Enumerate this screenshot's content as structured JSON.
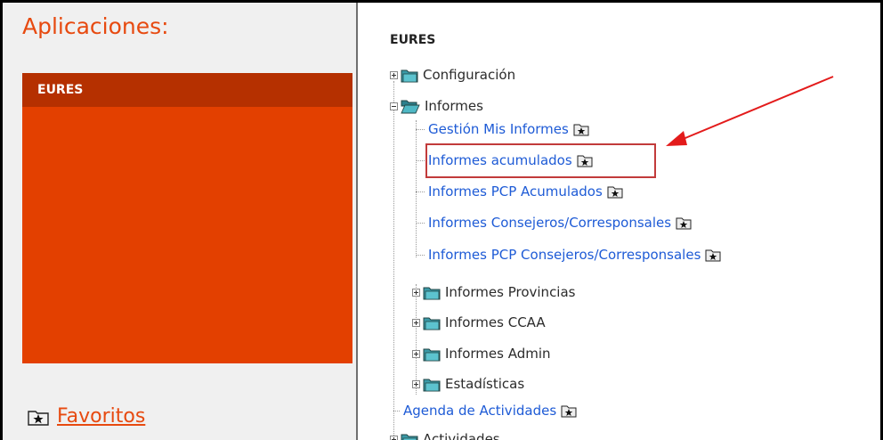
{
  "left_panel": {
    "title": "Aplicaciones:",
    "app_box_header": "EURES",
    "favorites_label": "Favoritos",
    "favorites_icon": "star-folder-icon"
  },
  "tree": {
    "title": "EURES",
    "configuracion": "Configuración",
    "informes": "Informes",
    "informes_children": [
      "Gestión Mis Informes",
      "Informes acumulados",
      "Informes PCP Acumulados",
      "Informes Consejeros/Corresponsales",
      "Informes PCP Consejeros/Corresponsales"
    ],
    "subfolders": [
      "Informes Provincias",
      "Informes CCAA",
      "Informes Admin",
      "Estadísticas"
    ],
    "agenda": "Agenda de Actividades",
    "actividades_partial": "Actividades"
  },
  "colors": {
    "accent_orange": "#e34000",
    "header_dark_orange": "#b53000",
    "link_blue": "#1e5bd6",
    "annotation_red": "#e31b1b"
  }
}
